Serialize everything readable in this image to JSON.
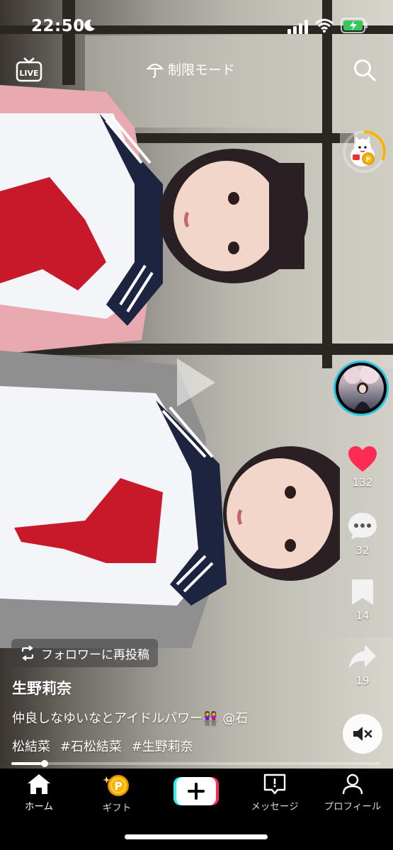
{
  "status_bar": {
    "time": "22:50"
  },
  "top_bar": {
    "live_label": "LIVE",
    "restricted_mode_label": "制限モード"
  },
  "right_rail": {
    "likes": "132",
    "comments": "32",
    "bookmarks": "14",
    "shares": "19",
    "accent_color": "#fe2c55",
    "avatar_ring_color": "#21c5e8"
  },
  "caption": {
    "repost_label": "フォロワーに再投稿",
    "author": "生野莉奈",
    "line1": "仲良しなゆいなとアイドルパワー👭 @石",
    "line2_prefix": "松結菜",
    "hashtags": [
      "#石松結菜",
      "#生野莉奈"
    ]
  },
  "playback": {
    "progress_fraction": 0.09
  },
  "bottom_nav": {
    "items": [
      {
        "label": "ホーム",
        "icon": "home-icon"
      },
      {
        "label": "ギフト",
        "icon": "gift-coin-icon"
      },
      {
        "label": "",
        "icon": "create-plus-icon"
      },
      {
        "label": "メッセージ",
        "icon": "message-icon"
      },
      {
        "label": "プロフィール",
        "icon": "profile-icon"
      }
    ]
  }
}
